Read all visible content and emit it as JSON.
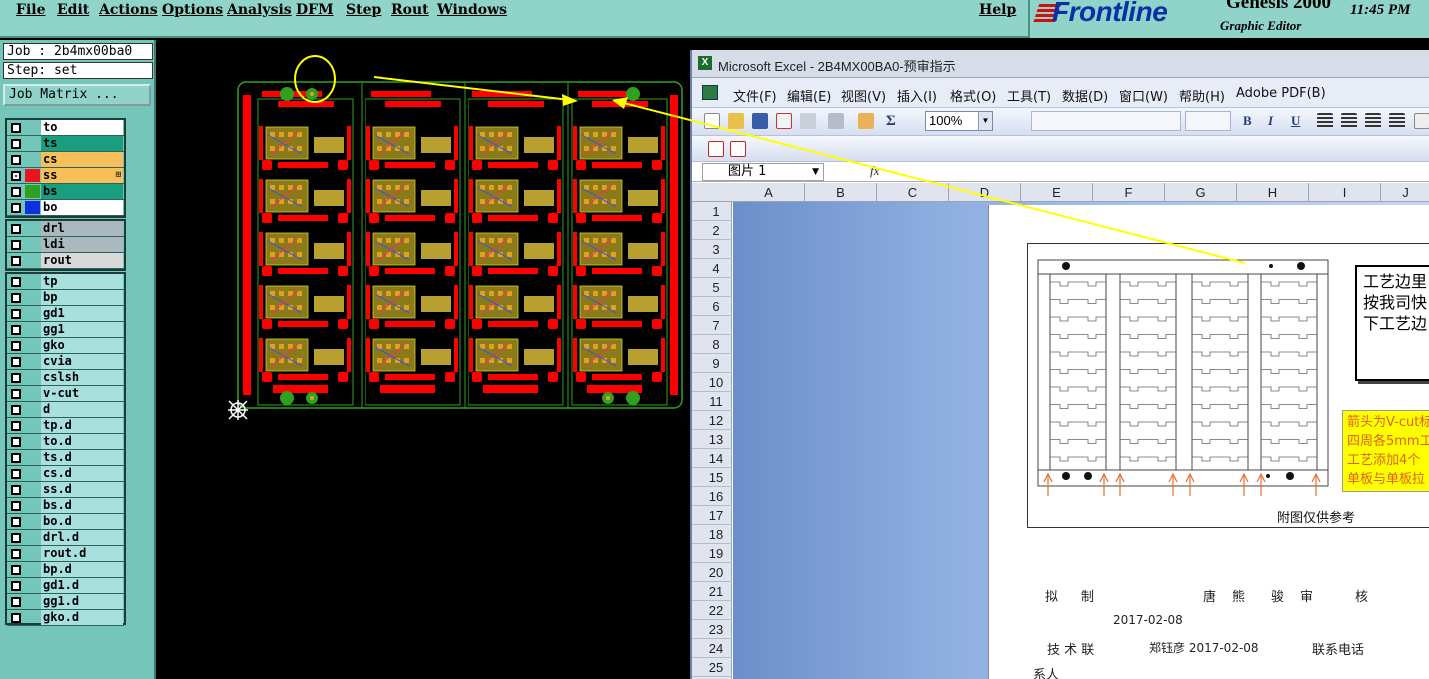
{
  "genesis": {
    "menu": [
      "File",
      "Edit",
      "Actions",
      "Options",
      "Analysis",
      "DFM",
      "Step",
      "Rout",
      "Windows"
    ],
    "help": "Help",
    "brand": "Frontline",
    "product": "Genesis 2000",
    "subtitle": "Graphic Editor",
    "clock": "11:45 PM",
    "job_label": "Job : 2b4mx00ba0",
    "step_label": "Step: set",
    "job_matrix_button": "Job Matrix ...",
    "layers_group1": [
      {
        "name": "to",
        "color": "#ffffff",
        "bg": "#ffffff"
      },
      {
        "name": "ts",
        "color": "#ffffff",
        "bg": "#1a9e80"
      },
      {
        "name": "cs",
        "color": "#ffffff",
        "bg": "#f5c05a"
      },
      {
        "name": "ss",
        "color": "#e8141e",
        "bg": "#f5c05a",
        "active": true
      },
      {
        "name": "bs",
        "color": "#2fa020",
        "bg": "#1a9e80"
      },
      {
        "name": "bo",
        "color": "#1030e0",
        "bg": "#ffffff"
      }
    ],
    "layers_group2": [
      {
        "name": "drl",
        "bg": "#a9b9bd"
      },
      {
        "name": "ldi",
        "bg": "#a9b9bd"
      },
      {
        "name": "rout",
        "bg": "#d9d9d9"
      }
    ],
    "layers_group3": [
      "tp",
      "bp",
      "gd1",
      "gg1",
      "gko",
      "cvia",
      "cslsh",
      "v-cut",
      "d",
      "tp.d",
      "to.d",
      "ts.d",
      "cs.d",
      "ss.d",
      "bs.d",
      "bo.d",
      "drl.d",
      "rout.d",
      "bp.d",
      "gd1.d",
      "gg1.d",
      "gko.d"
    ],
    "colors": {
      "menubar": "#8fd3c9",
      "panel": "#74c6ba",
      "pcb_red": "#ff0000",
      "pcb_green": "#2fa020",
      "annotation": "#ffff00"
    }
  },
  "excel": {
    "title": "Microsoft Excel - 2B4MX00BA0-预审指示",
    "menu": [
      "文件(F)",
      "编辑(E)",
      "视图(V)",
      "插入(I)",
      "格式(O)",
      "工具(T)",
      "数据(D)",
      "窗口(W)",
      "帮助(H)",
      "Adobe PDF(B)"
    ],
    "zoom": "100%",
    "name_box": "图片 1",
    "fx": "fx",
    "columns": [
      "A",
      "B",
      "C",
      "D",
      "E",
      "F",
      "G",
      "H",
      "I",
      "J"
    ],
    "rows": [
      "1",
      "2",
      "3",
      "4",
      "5",
      "6",
      "7",
      "8",
      "9",
      "10",
      "11",
      "12",
      "13",
      "14",
      "15",
      "16",
      "17",
      "18",
      "19",
      "20",
      "21",
      "22",
      "23",
      "24",
      "25"
    ],
    "figure_caption": "附图仅供参考",
    "note_box": [
      "工艺边里",
      "按我司快",
      "下工艺边"
    ],
    "yellow_note": [
      "箭头为V-cut标",
      "四周各5mm工",
      "工艺添加4个",
      "单板与单板拉"
    ],
    "sign_row1": [
      "拟",
      "制",
      "唐",
      "熊",
      "骏",
      "审",
      "核"
    ],
    "sign_date1": "2017-02-08",
    "sign_row2_label": "技 术 联",
    "sign_row2_name": "郑钰彦 2017-02-08",
    "sign_row2_phone": "联系电话",
    "sign_row3": "系人",
    "colors": {
      "title": "#d7dde8",
      "menubar": "#e7ecf6",
      "sheet_bg": "#8eaee0",
      "note_text": "#e0601a"
    }
  }
}
